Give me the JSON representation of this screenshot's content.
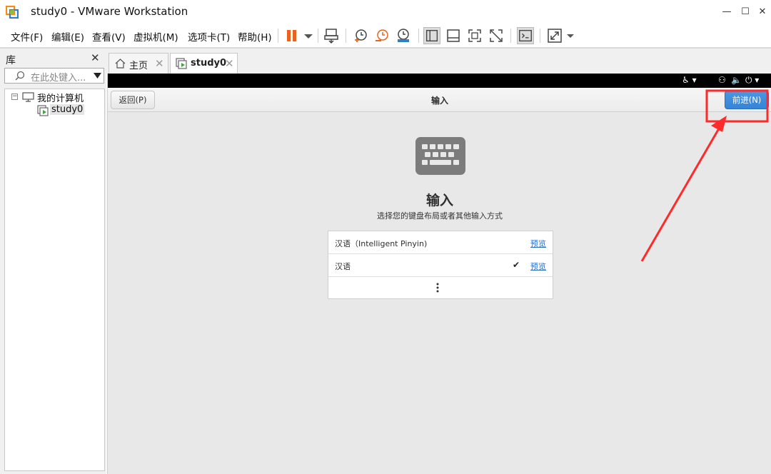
{
  "window": {
    "title": "study0 - VMware Workstation",
    "minimize_glyph": "—",
    "maximize_glyph": "☐",
    "close_glyph": "✕"
  },
  "menu": {
    "file": "文件(F)",
    "edit": "编辑(E)",
    "view": "查看(V)",
    "vm": "虚拟机(M)",
    "tabs": "选项卡(T)",
    "help": "帮助(H)"
  },
  "toolbar": {
    "icons": [
      "pause-icon",
      "send-keys-icon",
      "snapshot-icon",
      "revert-snapshot-icon",
      "manage-snapshots-icon",
      "library-view-icon",
      "thumbnail-view-icon",
      "fullscreen-icon",
      "unity-icon",
      "console-icon",
      "stretch-icon"
    ],
    "accent_color": "#e8641e"
  },
  "library": {
    "title": "库",
    "close_glyph": "✕",
    "search_placeholder": "在此处键入...",
    "tree": {
      "root": "我的计算机",
      "toggle": "−",
      "child": "study0"
    }
  },
  "tabs": [
    {
      "label": "主页"
    },
    {
      "label": "study0"
    }
  ],
  "guest": {
    "headerbar": {
      "back": "返回(P)",
      "title": "输入",
      "next": "前进(N)"
    },
    "heading": "输入",
    "subtitle": "选择您的键盘布局或者其他输入方式",
    "inputs": [
      {
        "label": "汉语（Intelligent Pinyin)",
        "link": "预览",
        "checked": false
      },
      {
        "label": "汉语",
        "link": "预览",
        "checked": true
      }
    ],
    "check_glyph": "✔",
    "colors": {
      "primary_button": "#3584d6",
      "link": "#2a6fc9"
    }
  },
  "annotation": {
    "color": "#ff2a2a"
  }
}
